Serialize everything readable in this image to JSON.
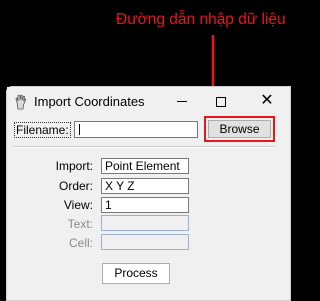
{
  "annotation": {
    "text": "Đường dẫn nhập dữ liệu",
    "color": "#e8161b"
  },
  "window": {
    "title": "Import Coordinates"
  },
  "filename": {
    "label": "Filename:",
    "value": "",
    "browse_label": "Browse"
  },
  "fields": {
    "import": {
      "label": "Import:",
      "value": "Point Element"
    },
    "order": {
      "label": "Order:",
      "value": "X Y Z"
    },
    "view": {
      "label": "View:",
      "value": "1"
    },
    "text": {
      "label": "Text:",
      "value": ""
    },
    "cell": {
      "label": "Cell:",
      "value": ""
    }
  },
  "actions": {
    "process_label": "Process"
  }
}
